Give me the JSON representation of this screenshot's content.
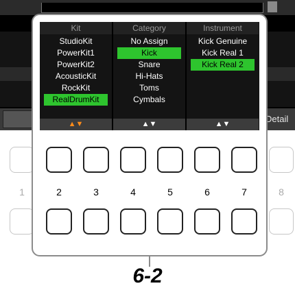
{
  "screen": {
    "detail_label": "Detail"
  },
  "columns": [
    {
      "header": "Kit",
      "items": [
        "StudioKit",
        "PowerKit1",
        "PowerKit2",
        "AcousticKit",
        "RockKit",
        "RealDrumKit"
      ],
      "selected_index": 5,
      "footer": "▲▼",
      "footer_color": "#ff8c1a"
    },
    {
      "header": "Category",
      "items": [
        "No Assign",
        "Kick",
        "Snare",
        "Hi-Hats",
        "Toms",
        "Cymbals"
      ],
      "selected_index": 1,
      "footer": "▲▼",
      "footer_color": "#ffffff"
    },
    {
      "header": "Instrument",
      "items": [
        "Kick Genuine",
        "Kick Real 1",
        "Kick Real 2"
      ],
      "selected_index": 2,
      "footer": "▲▼",
      "footer_color": "#ffffff"
    }
  ],
  "buttons": {
    "numbers": [
      "1",
      "2",
      "3",
      "4",
      "5",
      "6",
      "7",
      "8"
    ]
  },
  "step_label": "6-2",
  "colors": {
    "selection": "#2ec42e",
    "active_arrows": "#ff8c1a",
    "screen_bg": "#141414"
  }
}
